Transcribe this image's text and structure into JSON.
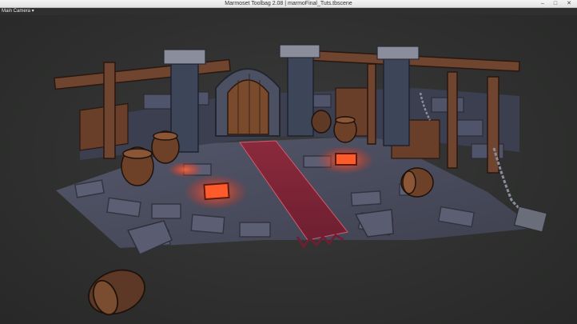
{
  "window": {
    "title": "Marmoset Toolbag 2.08  |  marmoFinal_Tuts.tbscene",
    "controls": {
      "minimize": "–",
      "maximize": "□",
      "close": "✕"
    }
  },
  "menubar": {
    "camera_menu": "Main Camera ▾"
  },
  "viewport": {
    "scene": "3D dungeon diorama",
    "colors": {
      "background": "#2e2f2e",
      "stone": "#4a4d5c",
      "wood": "#6a3f2a",
      "carpet": "#7a2437",
      "glow": "#ff4a2a"
    }
  }
}
